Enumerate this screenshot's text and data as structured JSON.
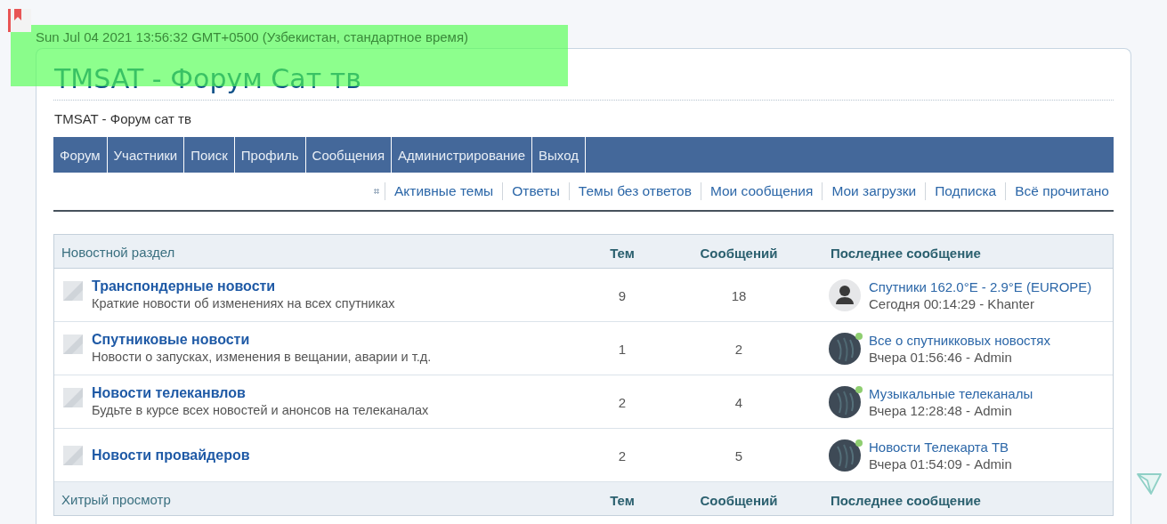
{
  "clock": "Sun Jul 04 2021 13:56:32 GMT+0500 (Узбекистан, стандартное время)",
  "site_title": "TMSAT - Форум Сат тв",
  "site_description": "TMSAT - Форум сат тв",
  "navbar": [
    "Форум",
    "Участники",
    "Поиск",
    "Профиль",
    "Сообщения",
    "Администрирование",
    "Выход"
  ],
  "quick_links": [
    "Активные темы",
    "Ответы",
    "Темы без ответов",
    "Мои сообщения",
    "Мои загрузки",
    "Подписка",
    "Всё прочитано"
  ],
  "categories": [
    {
      "title": "Новостной раздел",
      "columns": [
        "Тем",
        "Сообщений",
        "Последнее сообщение"
      ],
      "forums": [
        {
          "name": "Транспондерные новости",
          "description": "Краткие новости об изменениях на всех спутниках",
          "topics": "9",
          "posts": "18",
          "last_post": {
            "title": "Спутники 162.0°E - 2.9°E (EUROPE)",
            "meta": "Сегодня 00:14:29 - Khanter",
            "kind": "default",
            "online": false
          }
        },
        {
          "name": "Спутниковые новости",
          "description": "Новости о запусках, изменения в вещании, аварии и т.д.",
          "topics": "1",
          "posts": "2",
          "last_post": {
            "title": "Все о спутникковых новостях",
            "meta": "Вчера 01:56:46 - Admin",
            "kind": "custom",
            "online": true
          }
        },
        {
          "name": "Новости телеканвлов",
          "description": "Будьте в курсе всех новостей и анонсов на телеканалах",
          "topics": "2",
          "posts": "4",
          "last_post": {
            "title": "Музыкальные телеканалы",
            "meta": "Вчера 12:28:48 - Admin",
            "kind": "custom",
            "online": true
          }
        },
        {
          "name": "Новости провайдеров",
          "topics": "2",
          "posts": "5",
          "last_post": {
            "title": "Новости Телекарта ТВ",
            "meta": "Вчера 01:54:09 - Admin",
            "kind": "custom",
            "online": true
          }
        }
      ]
    },
    {
      "title": "Хитрый просмотр",
      "columns": [
        "Тем",
        "Сообщений",
        "Последнее сообщение"
      ]
    }
  ]
}
